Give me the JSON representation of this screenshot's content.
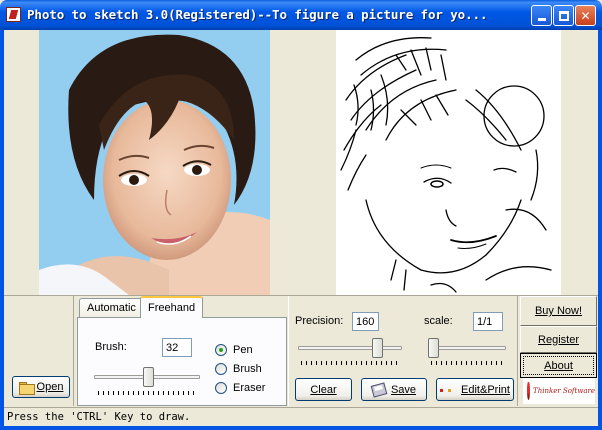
{
  "window": {
    "title": "Photo to sketch 3.0(Registered)--To figure a picture for yo...",
    "minimize_glyph": "",
    "maximize_glyph": "",
    "close_glyph": "✕"
  },
  "tabs": [
    {
      "label": "Automatic",
      "selected": false
    },
    {
      "label": "Freehand",
      "selected": true
    }
  ],
  "freehand": {
    "brush_label": "Brush:",
    "brush_value": "32",
    "tools": [
      {
        "label": "Pen",
        "selected": true
      },
      {
        "label": "Brush",
        "selected": false
      },
      {
        "label": "Eraser",
        "selected": false
      }
    ],
    "brush_slider_fraction": 0.52
  },
  "settings": {
    "precision_label": "Precision:",
    "precision_value": "160",
    "precision_slider_fraction": 0.8,
    "scale_label": "scale:",
    "scale_value": "1/1",
    "scale_slider_fraction": 0.0
  },
  "buttons": {
    "open": "Open",
    "clear": "Clear",
    "save": "Save",
    "edit_print": "Edit&Print",
    "buy_now": "Buy Now!",
    "register": "Register",
    "about": "About"
  },
  "logo_text": "Thinker Software",
  "status": "Press the 'CTRL' Key to draw.",
  "colors": {
    "title_bar": "#0058e6",
    "close_button": "#c8401c",
    "photo_background": "#8cc8ec",
    "sketch_background": "#ffffff"
  },
  "icons": [
    "app-icon",
    "minimize-icon",
    "maximize-icon",
    "close-icon",
    "folder-icon",
    "save-icon",
    "print-icon"
  ]
}
